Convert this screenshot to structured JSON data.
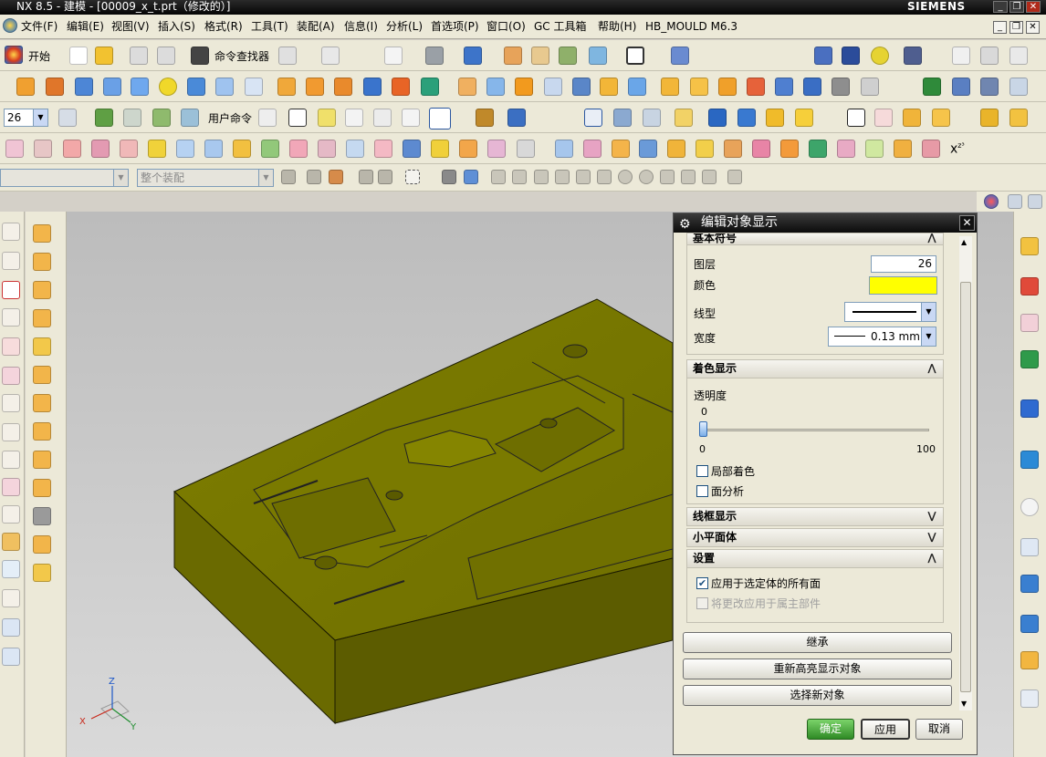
{
  "window": {
    "title": "NX 8.5 - 建模 - [00009_x_t.prt（修改的）]",
    "brand": "SIEMENS"
  },
  "menu": {
    "items": [
      "文件(F)",
      "编辑(E)",
      "视图(V)",
      "插入(S)",
      "格式(R)",
      "工具(T)",
      "装配(A)",
      "信息(I)",
      "分析(L)",
      "首选项(P)",
      "窗口(O)",
      "GC 工具箱",
      "帮助(H)",
      "HB_MOULD M6.3"
    ]
  },
  "toolbar": {
    "start_label": "开始",
    "command_finder_label": "命令查找器",
    "layer_value": "26",
    "user_commands_label": "用户命令",
    "filter_value": "",
    "scope_value": "整个装配"
  },
  "dialog": {
    "title": "编辑对象显示",
    "basic_section_label": "基本符号",
    "layer_label": "图层",
    "layer_value": "26",
    "color_label": "颜色",
    "color_value": "#ffff00",
    "linetype_label": "线型",
    "width_label": "宽度",
    "width_value": "0.13 mm",
    "shading_section_label": "着色显示",
    "transparency_label": "透明度",
    "transparency_value": "0",
    "transparency_min": "0",
    "transparency_max": "100",
    "transparency_fraction": 0,
    "partial_shading_label": "局部着色",
    "face_analysis_label": "面分析",
    "wireframe_section_label": "线框显示",
    "facet_section_label": "小平面体",
    "settings_section_label": "设置",
    "apply_all_faces_label": "应用于选定体的所有面",
    "apply_to_owner_label": "将更改应用于属主部件",
    "inherit_button": "继承",
    "rehighlight_button": "重新高亮显示对象",
    "select_new_button": "选择新对象",
    "ok_button": "确定",
    "apply_button": "应用",
    "cancel_button": "取消"
  },
  "triad": {
    "x_label": "X",
    "y_label": "Y",
    "z_label": "Z"
  },
  "colors": {
    "model_face": "#808000",
    "dialog_title_bg": "#1a1a1a",
    "ok_button_green": "#3d9a2f"
  }
}
